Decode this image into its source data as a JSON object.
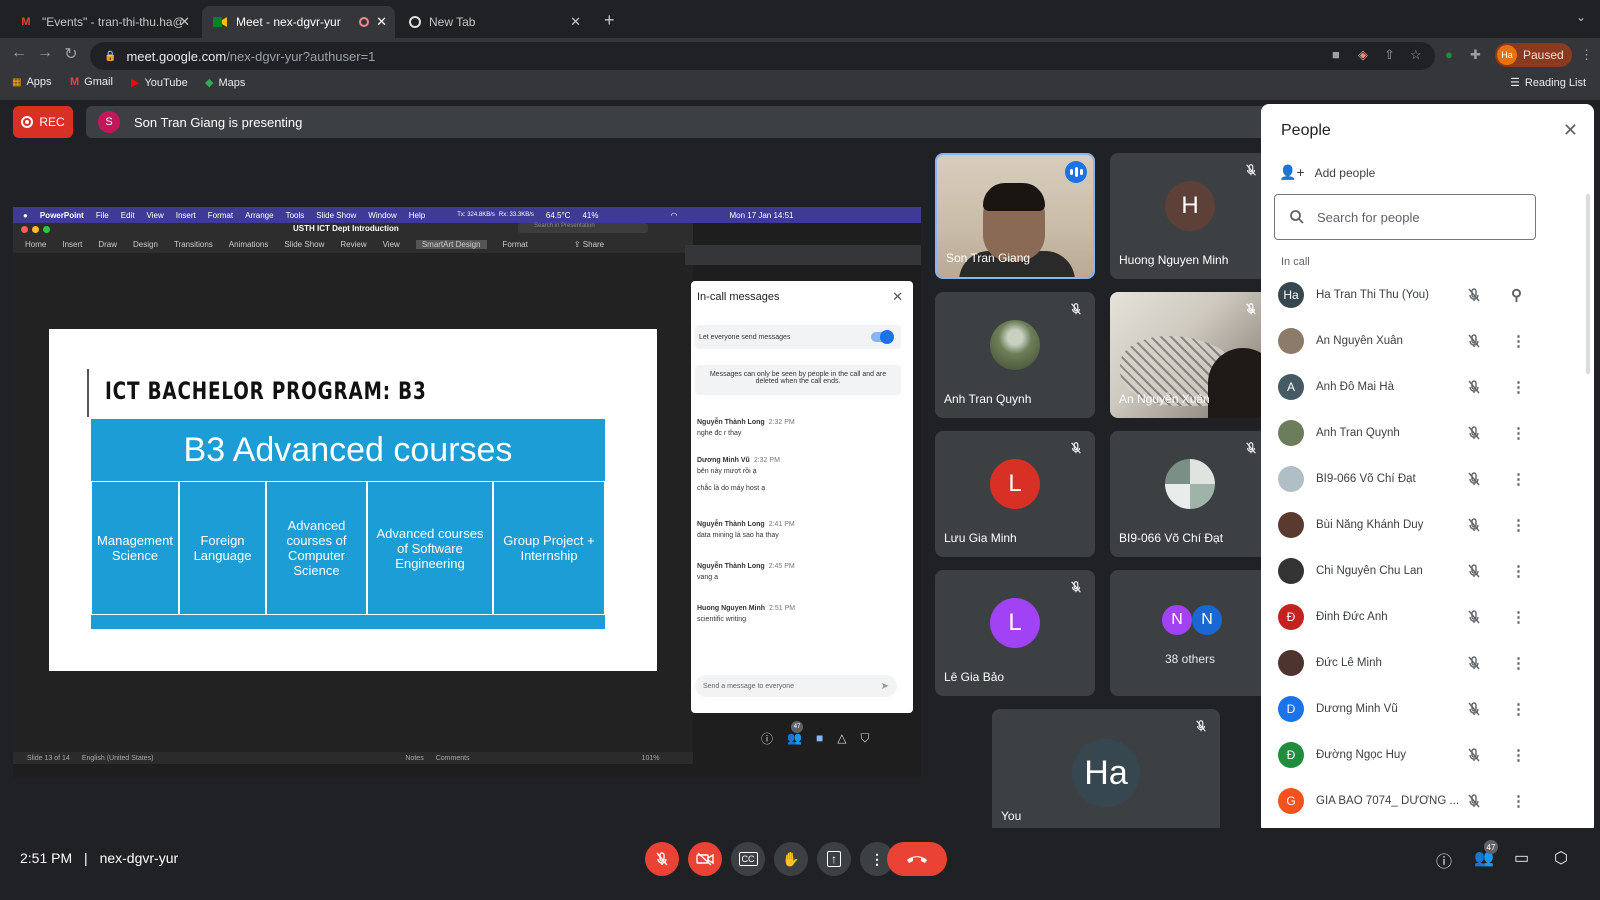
{
  "browser": {
    "tabs": [
      {
        "title": "\"Events\" - tran-thi-thu.ha@ust",
        "icon": "gmail-icon"
      },
      {
        "title": "Meet - nex-dgvr-yur",
        "icon": "meet-icon",
        "active": true
      },
      {
        "title": "New Tab",
        "icon": "chrome-icon"
      }
    ],
    "url_host": "meet.google.com",
    "url_path": "/nex-dgvr-yur?authuser=1",
    "profile_initials": "Ha",
    "profile_status": "Paused",
    "bookmarks": [
      "Apps",
      "Gmail",
      "YouTube",
      "Maps"
    ],
    "reading_list": "Reading List"
  },
  "meet": {
    "rec_label": "REC",
    "presenter_initial": "S",
    "presenting_text": "Son Tran Giang is presenting",
    "meeting_code": "nex-dgvr-yur",
    "time": "2:51 PM",
    "time_separator": "|",
    "participant_count_badge": "47"
  },
  "presentation": {
    "mac_menu": [
      "PowerPoint",
      "File",
      "Edit",
      "View",
      "Insert",
      "Format",
      "Arrange",
      "Tools",
      "Slide Show",
      "Window",
      "Help"
    ],
    "mac_status": {
      "network_up": "Tx: 324.8KB/s",
      "network_down": "Rx: 33.3KB/s",
      "temp": "64.5°C",
      "battery": "41%",
      "clock": "Mon 17 Jan 14:51"
    },
    "doc_title": "USTH ICT Dept Introduction",
    "search_placeholder": "Search in Presentation",
    "ribbon_tabs": [
      "Home",
      "Insert",
      "Draw",
      "Design",
      "Transitions",
      "Animations",
      "Slide Show",
      "Review",
      "View",
      "SmartArt Design",
      "Format"
    ],
    "share_label": "Share",
    "slide_title": "ICT BACHELOR PROGRAM: B3",
    "smartart_header": "B3 Advanced courses",
    "smartart_cells": [
      "Management Science",
      "Foreign Language",
      "Advanced courses of Computer Science",
      "Advanced courses of Software Engineering",
      "Group Project + Internship"
    ],
    "status_slide": "Slide 13 of 14",
    "status_lang": "English (United States)",
    "status_notes": "Notes",
    "status_comments": "Comments",
    "zoom": "101%"
  },
  "incall_messages": {
    "title": "In-call messages",
    "toggle_label": "Let everyone send messages",
    "toggle_on": true,
    "info_note": "Messages can only be seen by people in the call and are deleted when the call ends.",
    "messages": [
      {
        "sender": "Nguyễn Thành Long",
        "time": "2:32 PM",
        "lines": [
          "nghe đc r thay"
        ]
      },
      {
        "sender": "Dương Minh Vũ",
        "time": "2:32 PM",
        "lines": [
          "bên này mượt rồi ạ",
          "chắc là do máy host ạ"
        ]
      },
      {
        "sender": "Nguyễn Thành Long",
        "time": "2:41 PM",
        "lines": [
          "data mining là sao ha thay"
        ]
      },
      {
        "sender": "Nguyễn Thành Long",
        "time": "2:45 PM",
        "lines": [
          "vang a"
        ]
      },
      {
        "sender": "Huong Nguyen Minh",
        "time": "2:51 PM",
        "lines": [
          "scientific writing"
        ]
      }
    ],
    "send_placeholder": "Send a message to everyone",
    "mini_badge": "47"
  },
  "tiles": [
    {
      "name": "Son Tran Giang",
      "kind": "video"
    },
    {
      "name": "Huong Nguyen Minh",
      "initial": "H",
      "color": "#5d4037"
    },
    {
      "name": "Anh Tran Quynh",
      "kind": "photo"
    },
    {
      "name": "An Nguyễn Xuân",
      "kind": "video2"
    },
    {
      "name": "Lưu Gia Minh",
      "initial": "L",
      "color": "#d93025"
    },
    {
      "name": "BI9-066 Võ Chí Đạt",
      "kind": "photo"
    },
    {
      "name": "Lê Gia Bảo",
      "initial": "L",
      "color": "#a142f4"
    },
    {
      "name": "38 others",
      "initials": [
        "N",
        "N"
      ],
      "colors": [
        "#a142f4",
        "#1967d2"
      ]
    },
    {
      "name": "You",
      "initial": "Ha",
      "color": "#37474f"
    }
  ],
  "people_panel": {
    "title": "People",
    "add_people": "Add people",
    "search_placeholder": "Search for people",
    "section": "In call",
    "people": [
      {
        "name": "Ha Tran Thi Thu (You)",
        "initial": "Ha",
        "color": "#37474f",
        "pin": true
      },
      {
        "name": "An Nguyễn Xuân",
        "initial": "",
        "color": "#8d7b6a"
      },
      {
        "name": "Anh Đỗ Mai Hà",
        "initial": "A",
        "color": "#455a64"
      },
      {
        "name": "Anh Tran Quynh",
        "initial": "",
        "color": "#6b7d5c"
      },
      {
        "name": "BI9-066 Võ Chí Đạt",
        "initial": "",
        "color": "#b0bec5"
      },
      {
        "name": "Bùi Năng Khánh Duy",
        "initial": "",
        "color": "#5a3a2e"
      },
      {
        "name": "Chi Nguyễn Chu Lan",
        "initial": "",
        "color": "#333333"
      },
      {
        "name": "Đinh Đức Anh",
        "initial": "Đ",
        "color": "#c5221f"
      },
      {
        "name": "Đức Lê Minh",
        "initial": "",
        "color": "#4e342e"
      },
      {
        "name": "Dương Minh Vũ",
        "initial": "D",
        "color": "#1a73e8"
      },
      {
        "name": "Đường Ngọc Huy",
        "initial": "Đ",
        "color": "#1e8e3e"
      },
      {
        "name": "GIA BẢO 7074_ DƯƠNG ...",
        "initial": "G",
        "color": "#f4511e"
      }
    ]
  }
}
